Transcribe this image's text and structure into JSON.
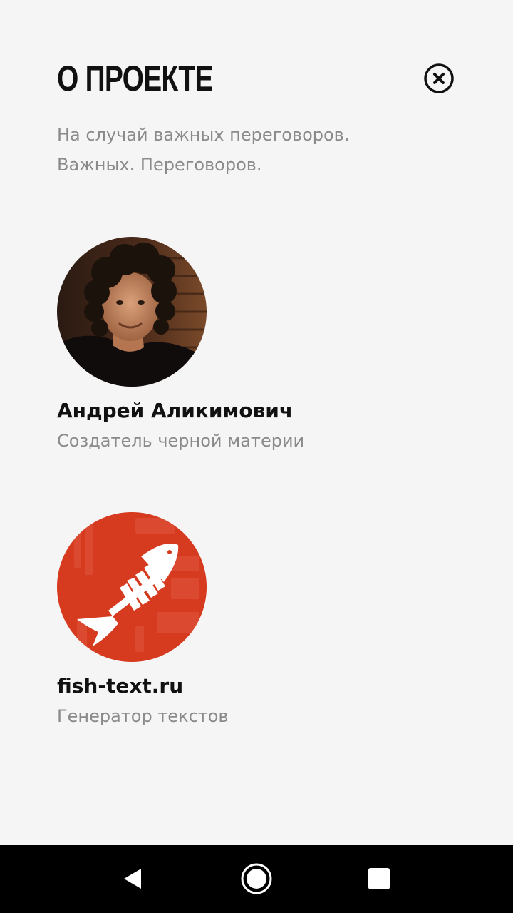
{
  "header": {
    "title": "О ПРОЕКТЕ",
    "close_icon": "close-circle-icon"
  },
  "intro": {
    "line1": "На случай важных переговоров.",
    "line2": "Важных. Переговоров."
  },
  "cards": [
    {
      "name": "Андрей Аликимович",
      "role": "Создатель черной материи",
      "avatar": "author-photo"
    },
    {
      "name": "fish-text.ru",
      "role": "Генератор текстов",
      "avatar": "fish-skeleton-logo"
    }
  ],
  "navbar": {
    "back_icon": "back-triangle-icon",
    "home_icon": "home-circle-icon",
    "recents_icon": "recents-square-icon"
  },
  "colors": {
    "background": "#f5f5f5",
    "title": "#111111",
    "secondary_text": "#8a8a8a",
    "fish_logo": "#d63a1f",
    "navbar": "#000000"
  }
}
